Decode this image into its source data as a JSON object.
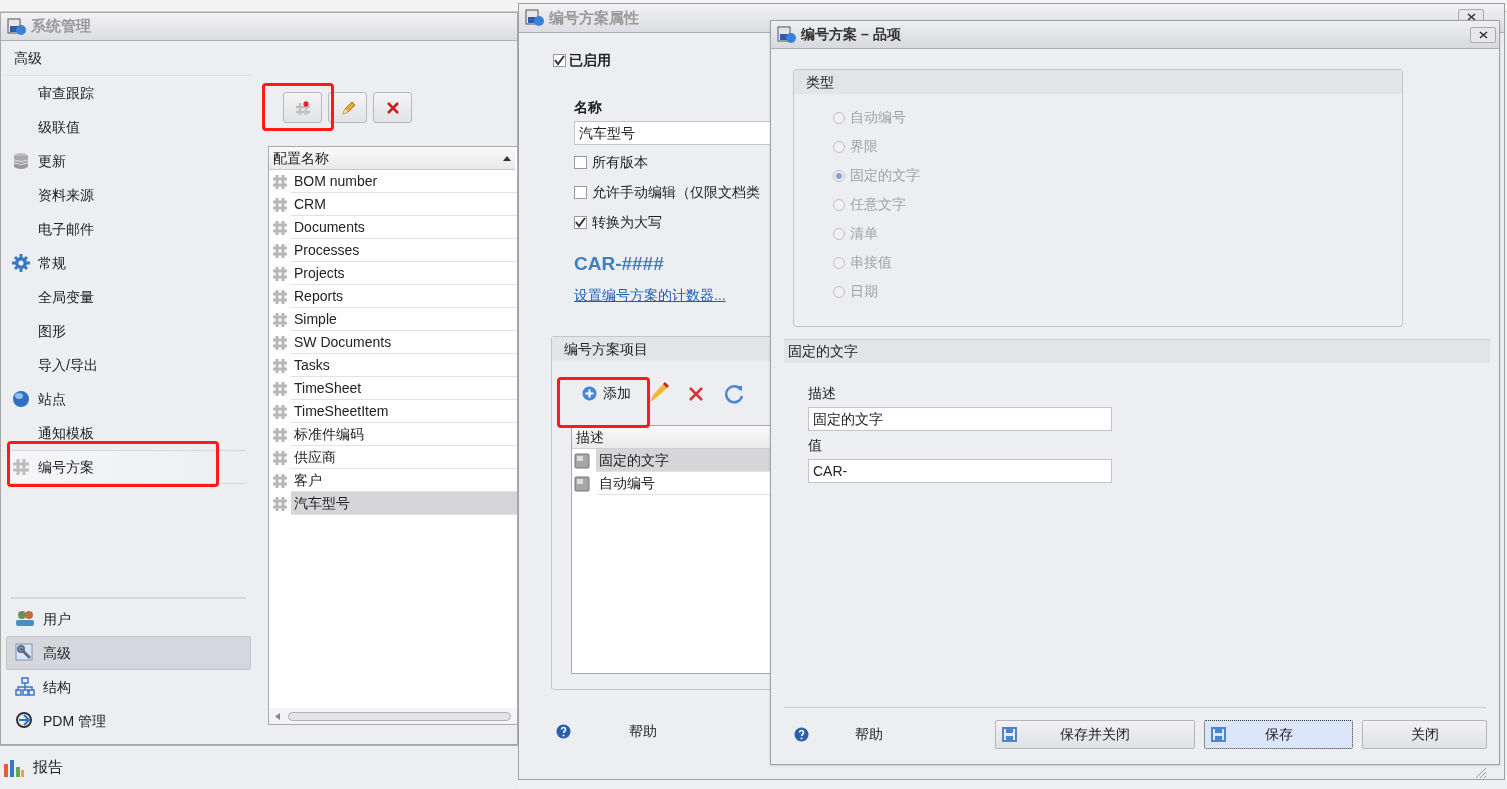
{
  "main_window": {
    "title": "系统管理",
    "nav": {
      "header": "高级",
      "items": [
        {
          "label": "审查跟踪",
          "kind": "item",
          "selected": false
        },
        {
          "label": "级联值",
          "kind": "item",
          "selected": false
        },
        {
          "label": "更新",
          "kind": "category",
          "selected": false
        },
        {
          "label": "资料来源",
          "kind": "item",
          "selected": false
        },
        {
          "label": "电子邮件",
          "kind": "item",
          "selected": false
        },
        {
          "label": "常规",
          "kind": "category",
          "selected": false
        },
        {
          "label": "全局变量",
          "kind": "item",
          "selected": false
        },
        {
          "label": "图形",
          "kind": "item",
          "selected": false
        },
        {
          "label": "导入/导出",
          "kind": "item",
          "selected": false
        },
        {
          "label": "站点",
          "kind": "category",
          "selected": false
        },
        {
          "label": "通知模板",
          "kind": "item",
          "selected": false
        },
        {
          "label": "编号方案",
          "kind": "category",
          "selected": true
        }
      ]
    },
    "sections": [
      {
        "label": "用户",
        "selected": false
      },
      {
        "label": "高级",
        "selected": true
      },
      {
        "label": "结构",
        "selected": false
      },
      {
        "label": "PDM 管理",
        "selected": false
      }
    ],
    "list": {
      "columns": [
        "配置名称"
      ],
      "rows": [
        {
          "label": "BOM number",
          "selected": false
        },
        {
          "label": "CRM",
          "selected": false
        },
        {
          "label": "Documents",
          "selected": false
        },
        {
          "label": "Processes",
          "selected": false
        },
        {
          "label": "Projects",
          "selected": false
        },
        {
          "label": "Reports",
          "selected": false
        },
        {
          "label": "Simple",
          "selected": false
        },
        {
          "label": "SW Documents",
          "selected": false
        },
        {
          "label": "Tasks",
          "selected": false
        },
        {
          "label": "TimeSheet",
          "selected": false
        },
        {
          "label": "TimeSheetItem",
          "selected": false
        },
        {
          "label": "标准件编码",
          "selected": false
        },
        {
          "label": "供应商",
          "selected": false
        },
        {
          "label": "客户",
          "selected": false
        },
        {
          "label": "汽车型号",
          "selected": true
        }
      ]
    }
  },
  "report_bar": {
    "label": "报告"
  },
  "scheme_window": {
    "title": "编号方案属性",
    "enabled": {
      "label": "已启用",
      "checked": true
    },
    "name_label": "名称",
    "name_value": "汽车型号",
    "options": [
      {
        "label": "所有版本",
        "checked": false
      },
      {
        "label": "允许手动编辑（仅限文档类",
        "checked": false
      },
      {
        "label": "转换为大写",
        "checked": true
      }
    ],
    "pattern": "CAR-####",
    "counter_link": "设置编号方案的计数器...",
    "items_group": {
      "title": "编号方案项目",
      "add_label": "添加",
      "columns": [
        "描述"
      ],
      "rows": [
        {
          "label": "固定的文字",
          "selected": true
        },
        {
          "label": "自动编号",
          "selected": false
        }
      ]
    },
    "help": "帮助"
  },
  "item_window": {
    "title": "编号方案 – 品项",
    "type_group": {
      "title": "类型",
      "disabled": true,
      "options": [
        {
          "label": "自动编号",
          "selected": false
        },
        {
          "label": "界限",
          "selected": false
        },
        {
          "label": "固定的文字",
          "selected": true
        },
        {
          "label": "任意文字",
          "selected": false
        },
        {
          "label": "清单",
          "selected": false
        },
        {
          "label": "串接值",
          "selected": false
        },
        {
          "label": "日期",
          "selected": false
        }
      ]
    },
    "section_title": "固定的文字",
    "fields": [
      {
        "label": "描述",
        "value": "固定的文字"
      },
      {
        "label": "值",
        "value": "CAR-"
      }
    ],
    "help": "帮助",
    "buttons": [
      {
        "label": "保存并关闭",
        "kind": "save",
        "focused": false
      },
      {
        "label": "保存",
        "kind": "save",
        "focused": true
      },
      {
        "label": "关闭",
        "kind": "plain",
        "focused": false
      }
    ]
  }
}
